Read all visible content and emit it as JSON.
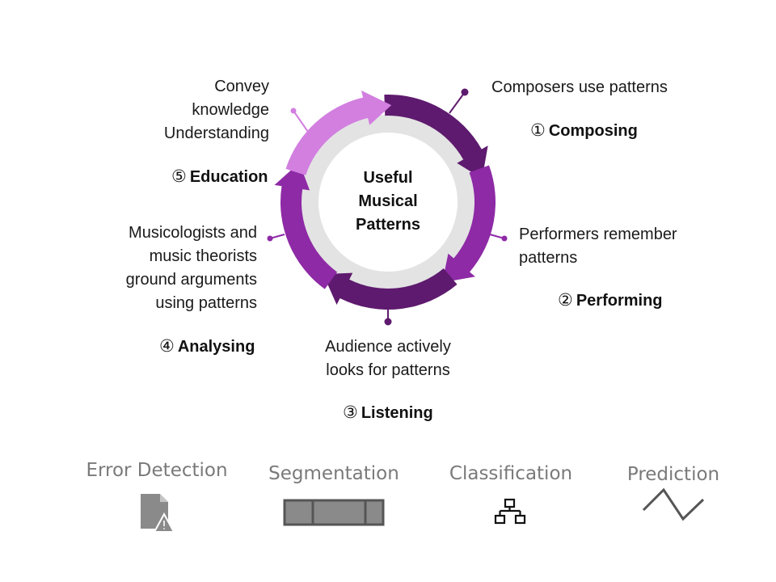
{
  "center": {
    "lines": [
      "Useful",
      "Musical",
      "Patterns"
    ]
  },
  "stages": {
    "composing": {
      "number": "①",
      "name": "Composing",
      "description": [
        "Composers use patterns"
      ]
    },
    "performing": {
      "number": "②",
      "name": "Performing",
      "description": [
        "Performers remember",
        "patterns"
      ]
    },
    "listening": {
      "number": "③",
      "name": "Listening",
      "description": [
        "Audience actively",
        "looks for patterns"
      ]
    },
    "analysing": {
      "number": "④",
      "name": "Analysing",
      "description": [
        "Musicologists and",
        "music theorists",
        "ground arguments",
        "using patterns"
      ]
    },
    "education": {
      "number": "⑤",
      "name": "Education",
      "description": [
        "Convey",
        "knowledge",
        "Understanding"
      ]
    }
  },
  "tasks": [
    {
      "label": "Error Detection",
      "icon": "file-warning-icon"
    },
    {
      "label": "Segmentation",
      "icon": "segmented-bar-icon"
    },
    {
      "label": "Classification",
      "icon": "hierarchy-icon"
    },
    {
      "label": "Prediction",
      "icon": "zigzag-icon"
    }
  ],
  "colors": {
    "dark_purple": "#5e1a6e",
    "mid_purple": "#8e2aa6",
    "light_purple": "#d27fe0",
    "ring_gray": "#e3e3e3",
    "icon_gray": "#8a8a8a"
  }
}
